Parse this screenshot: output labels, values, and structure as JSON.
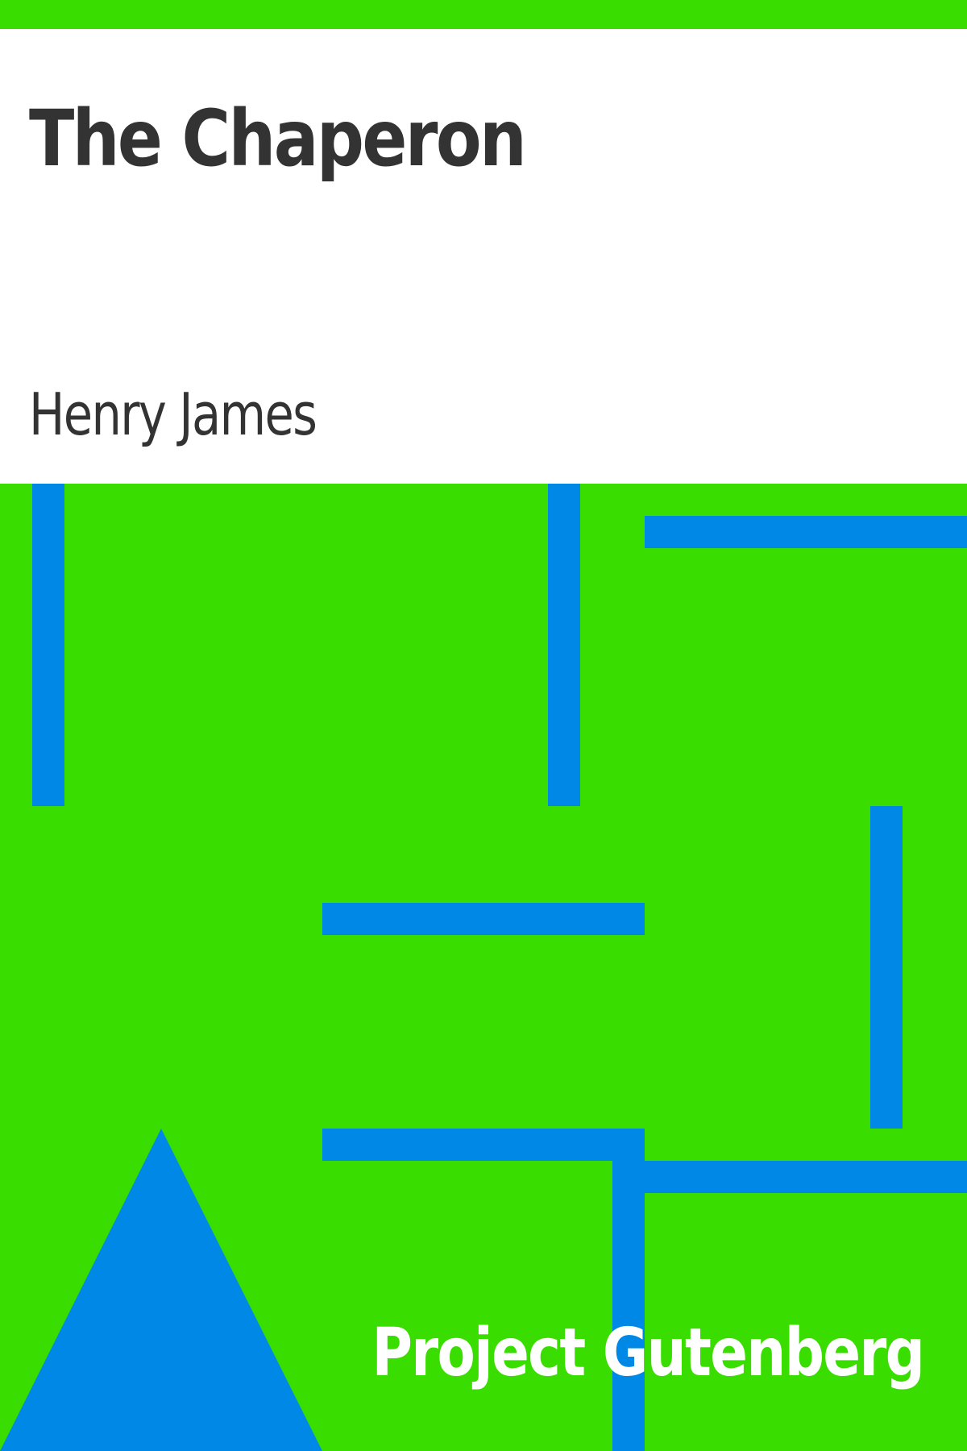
{
  "cover": {
    "title": "The Chaperon",
    "author": "Henry James",
    "publisher": "Project Gutenberg"
  },
  "colors": {
    "background": "#39dd00",
    "panel": "#ffffff",
    "text": "#333333",
    "accent": "#0088e6",
    "publisher_text": "#ffffff"
  }
}
